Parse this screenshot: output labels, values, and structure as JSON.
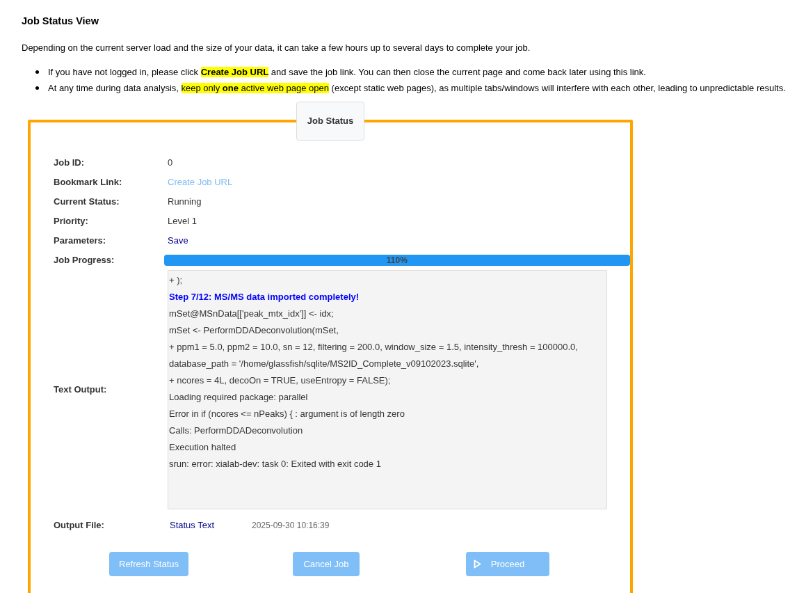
{
  "title": "Job Status View",
  "intro": "Depending on the current server load and the size of your data, it can take a few hours up to several days to complete your job.",
  "notes": [
    [
      {
        "text": "If you have not logged in, please click ",
        "highlighted": false
      },
      {
        "text": "**Create Job URL**",
        "highlighted": true
      },
      {
        "text": " and save the job link. You can then close the current page and come back later using this link.",
        "highlighted": false
      }
    ],
    [
      {
        "text": "At any time during data analysis, ",
        "highlighted": false
      },
      {
        "text": "keep only **one** active web page open",
        "highlighted": true
      },
      {
        "text": " (except static web pages), as multiple tabs/windows will interfere with each other, leading to unpredictable results.",
        "highlighted": false
      }
    ]
  ],
  "panel": {
    "legend": "Job Status",
    "rows": [
      {
        "label": "Job ID:",
        "kind": "text",
        "value": "0"
      },
      {
        "label": "Bookmark Link:",
        "kind": "link",
        "value": "Create Job URL"
      },
      {
        "label": "Current Status:",
        "kind": "text",
        "value": "Running"
      },
      {
        "label": "Priority:",
        "kind": "text",
        "value": "Level 1"
      },
      {
        "label": "Parameters:",
        "kind": "darklink",
        "value": "Save"
      },
      {
        "label": "Job Progress:",
        "kind": "progress",
        "level": 1,
        "reading": "110%"
      },
      {
        "label": "Text Output:",
        "kind": "log",
        "lines": [
          {
            "text": "+ );",
            "kind": "plain"
          },
          {
            "text": "Step 7/12: MS/MS data imported completely!",
            "kind": "step"
          },
          {
            "text": "mSet@MSnData[['peak_mtx_idx']] <- idx;",
            "kind": "plain"
          },
          {
            "text": "mSet <- PerformDDADeconvolution(mSet,",
            "kind": "plain"
          },
          {
            "text": "+ ppm1 = 5.0, ppm2 = 10.0, sn = 12, filtering = 200.0, window_size = 1.5, intensity_thresh = 100000.0,",
            "kind": "plain"
          },
          {
            "text": "database_path = '/home/glassfish/sqlite/MS2ID_Complete_v09102023.sqlite',",
            "kind": "plain"
          },
          {
            "text": "+ ncores = 4L, decoOn = TRUE, useEntropy = FALSE);",
            "kind": "plain"
          },
          {
            "text": "Loading required package: parallel",
            "kind": "plain"
          },
          {
            "text": "Error in if (ncores <= nPeaks) { : argument is of length zero",
            "kind": "plain"
          },
          {
            "text": "Calls: PerformDDADeconvolution",
            "kind": "plain"
          },
          {
            "text": "Execution halted",
            "kind": "plain"
          },
          {
            "text": "srun: error: xialab-dev: task 0: Exited with exit code 1",
            "kind": "plain"
          }
        ]
      },
      {
        "label": "Output File:",
        "kind": "file",
        "value": "Status Text",
        "time": "2025-09-30 10:16:39"
      }
    ],
    "buttons": [
      {
        "label": "Refresh Status",
        "kind": "plain",
        "disabled": true
      },
      {
        "label": "Cancel Job",
        "kind": "plain",
        "disabled": true
      },
      {
        "label": "Proceed",
        "kind": "play",
        "disabled": true
      }
    ]
  }
}
